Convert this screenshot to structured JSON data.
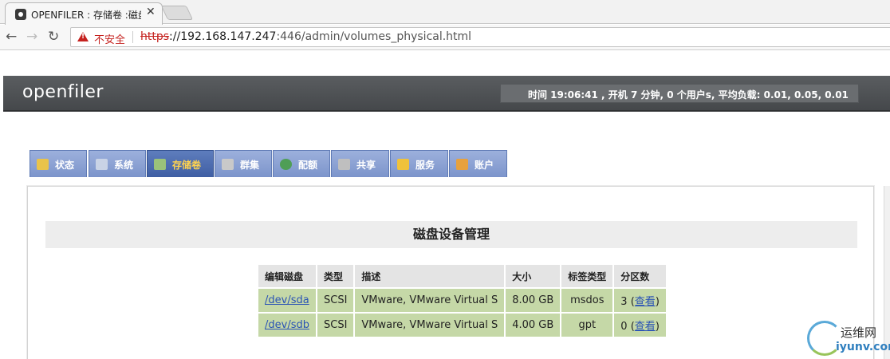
{
  "browser": {
    "tab_title": "OPENFILER : 存储卷 :磁盘",
    "tab_close": "✕",
    "nav_back": "←",
    "nav_forward": "→",
    "nav_reload": "↻",
    "security_label": "不安全",
    "url_scheme": "https",
    "url_host": "://192.168.147.247",
    "url_rest": ":446/admin/volumes_physical.html"
  },
  "header": {
    "logo": "openfiler",
    "status": "时间 19:06:41 , 开机 7 分钟, 0 个用户s, 平均负载: 0.01, 0.05, 0.01"
  },
  "nav": {
    "items": [
      {
        "label": "状态",
        "icon": "status-icon",
        "color": "#e9c34a"
      },
      {
        "label": "系统",
        "icon": "system-icon",
        "color": "#c9d3e6"
      },
      {
        "label": "存储卷",
        "icon": "volumes-icon",
        "color": "#9ac27a"
      },
      {
        "label": "群集",
        "icon": "cluster-icon",
        "color": "#c9c9c9"
      },
      {
        "label": "配额",
        "icon": "quota-icon",
        "color": "#4f9e56"
      },
      {
        "label": "共享",
        "icon": "shares-icon",
        "color": "#bfbfbf"
      },
      {
        "label": "服务",
        "icon": "services-icon",
        "color": "#f0c23a"
      },
      {
        "label": "账户",
        "icon": "accounts-icon",
        "color": "#e7a13e"
      }
    ],
    "active": "存储卷"
  },
  "main": {
    "section_title": "磁盘设备管理",
    "table": {
      "headers": [
        "编辑磁盘",
        "类型",
        "描述",
        "大小",
        "标签类型",
        "分区数"
      ],
      "rows": [
        {
          "disk": "/dev/sda",
          "type": "SCSI",
          "desc": "VMware, VMware Virtual S",
          "size": "8.00 GB",
          "label": "msdos",
          "parts": "3",
          "view": "查看"
        },
        {
          "disk": "/dev/sdb",
          "type": "SCSI",
          "desc": "VMware, VMware Virtual S",
          "size": "4.00 GB",
          "label": "gpt",
          "parts": "0",
          "view": "查看"
        }
      ]
    }
  },
  "watermark": {
    "cn": "运维网",
    "en": "iyunv.com"
  }
}
